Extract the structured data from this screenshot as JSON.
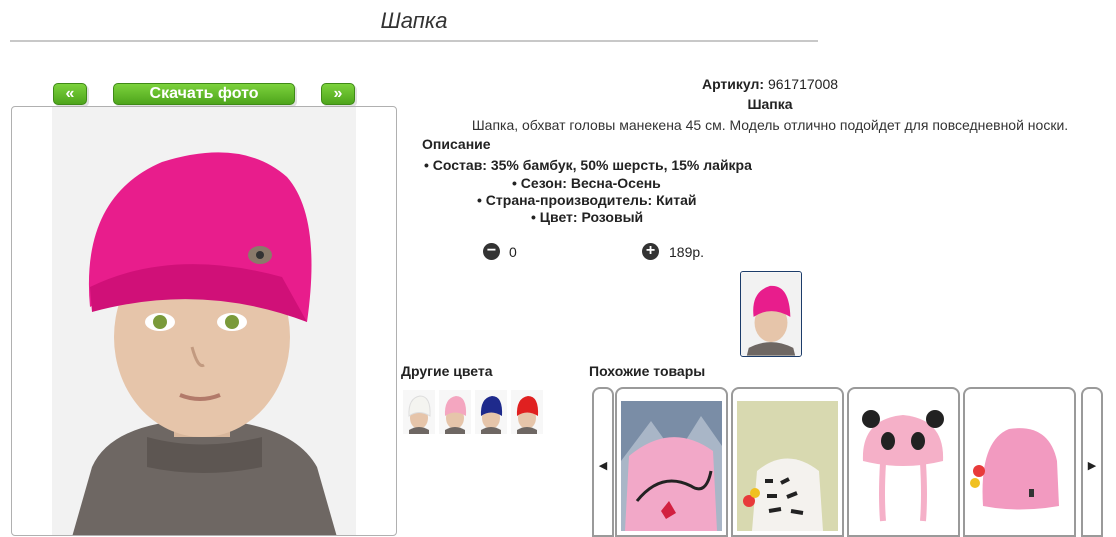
{
  "page": {
    "title": "Шапка"
  },
  "photo_nav": {
    "prev_label": "«",
    "download_label": "Скачать фото",
    "next_label": "»"
  },
  "product": {
    "article_label": "Артикул:",
    "article_value": "961717008",
    "name": "Шапка",
    "description": "Шапка, обхват головы манекена 45 см. Модель отлично подойдет для повседневной носки.",
    "description_heading": "Описание",
    "specs": [
      "Состав: 35% бамбук, 50% шерсть, 15% лайкра",
      "Сезон: Весна-Осень",
      "Страна-производитель: Китай",
      "Цвет: Розовый"
    ]
  },
  "cart": {
    "minus_symbol": "−",
    "plus_symbol": "+",
    "quantity": "0",
    "price": "189р."
  },
  "other_colors": {
    "title": "Другие цвета",
    "colors": [
      "#f4f4f0",
      "#f4a6c0",
      "#1e2a8c",
      "#e02020"
    ]
  },
  "similar": {
    "title": "Похожие товары",
    "left_arrow": "◀",
    "right_arrow": "▶",
    "items": [
      "pink-printed-beanie",
      "white-letter-beanie",
      "pink-panda-hat",
      "pink-beanie"
    ]
  },
  "colors": {
    "accent_green": "#5cb52a",
    "product_pink": "#e81d8c"
  }
}
